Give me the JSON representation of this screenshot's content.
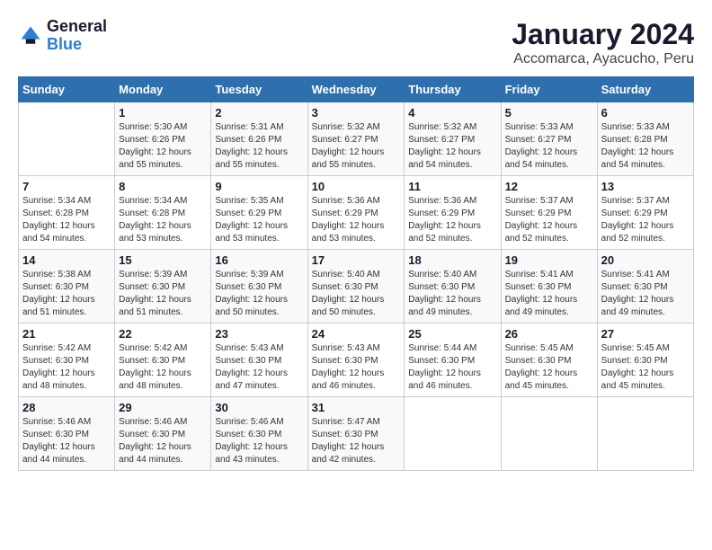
{
  "logo": {
    "text_general": "General",
    "text_blue": "Blue"
  },
  "header": {
    "title": "January 2024",
    "subtitle": "Accomarca, Ayacucho, Peru"
  },
  "columns": [
    "Sunday",
    "Monday",
    "Tuesday",
    "Wednesday",
    "Thursday",
    "Friday",
    "Saturday"
  ],
  "weeks": [
    [
      {
        "day": "",
        "info": ""
      },
      {
        "day": "1",
        "info": "Sunrise: 5:30 AM\nSunset: 6:26 PM\nDaylight: 12 hours\nand 55 minutes."
      },
      {
        "day": "2",
        "info": "Sunrise: 5:31 AM\nSunset: 6:26 PM\nDaylight: 12 hours\nand 55 minutes."
      },
      {
        "day": "3",
        "info": "Sunrise: 5:32 AM\nSunset: 6:27 PM\nDaylight: 12 hours\nand 55 minutes."
      },
      {
        "day": "4",
        "info": "Sunrise: 5:32 AM\nSunset: 6:27 PM\nDaylight: 12 hours\nand 54 minutes."
      },
      {
        "day": "5",
        "info": "Sunrise: 5:33 AM\nSunset: 6:27 PM\nDaylight: 12 hours\nand 54 minutes."
      },
      {
        "day": "6",
        "info": "Sunrise: 5:33 AM\nSunset: 6:28 PM\nDaylight: 12 hours\nand 54 minutes."
      }
    ],
    [
      {
        "day": "7",
        "info": "Sunrise: 5:34 AM\nSunset: 6:28 PM\nDaylight: 12 hours\nand 54 minutes."
      },
      {
        "day": "8",
        "info": "Sunrise: 5:34 AM\nSunset: 6:28 PM\nDaylight: 12 hours\nand 53 minutes."
      },
      {
        "day": "9",
        "info": "Sunrise: 5:35 AM\nSunset: 6:29 PM\nDaylight: 12 hours\nand 53 minutes."
      },
      {
        "day": "10",
        "info": "Sunrise: 5:36 AM\nSunset: 6:29 PM\nDaylight: 12 hours\nand 53 minutes."
      },
      {
        "day": "11",
        "info": "Sunrise: 5:36 AM\nSunset: 6:29 PM\nDaylight: 12 hours\nand 52 minutes."
      },
      {
        "day": "12",
        "info": "Sunrise: 5:37 AM\nSunset: 6:29 PM\nDaylight: 12 hours\nand 52 minutes."
      },
      {
        "day": "13",
        "info": "Sunrise: 5:37 AM\nSunset: 6:29 PM\nDaylight: 12 hours\nand 52 minutes."
      }
    ],
    [
      {
        "day": "14",
        "info": "Sunrise: 5:38 AM\nSunset: 6:30 PM\nDaylight: 12 hours\nand 51 minutes."
      },
      {
        "day": "15",
        "info": "Sunrise: 5:39 AM\nSunset: 6:30 PM\nDaylight: 12 hours\nand 51 minutes."
      },
      {
        "day": "16",
        "info": "Sunrise: 5:39 AM\nSunset: 6:30 PM\nDaylight: 12 hours\nand 50 minutes."
      },
      {
        "day": "17",
        "info": "Sunrise: 5:40 AM\nSunset: 6:30 PM\nDaylight: 12 hours\nand 50 minutes."
      },
      {
        "day": "18",
        "info": "Sunrise: 5:40 AM\nSunset: 6:30 PM\nDaylight: 12 hours\nand 49 minutes."
      },
      {
        "day": "19",
        "info": "Sunrise: 5:41 AM\nSunset: 6:30 PM\nDaylight: 12 hours\nand 49 minutes."
      },
      {
        "day": "20",
        "info": "Sunrise: 5:41 AM\nSunset: 6:30 PM\nDaylight: 12 hours\nand 49 minutes."
      }
    ],
    [
      {
        "day": "21",
        "info": "Sunrise: 5:42 AM\nSunset: 6:30 PM\nDaylight: 12 hours\nand 48 minutes."
      },
      {
        "day": "22",
        "info": "Sunrise: 5:42 AM\nSunset: 6:30 PM\nDaylight: 12 hours\nand 48 minutes."
      },
      {
        "day": "23",
        "info": "Sunrise: 5:43 AM\nSunset: 6:30 PM\nDaylight: 12 hours\nand 47 minutes."
      },
      {
        "day": "24",
        "info": "Sunrise: 5:43 AM\nSunset: 6:30 PM\nDaylight: 12 hours\nand 46 minutes."
      },
      {
        "day": "25",
        "info": "Sunrise: 5:44 AM\nSunset: 6:30 PM\nDaylight: 12 hours\nand 46 minutes."
      },
      {
        "day": "26",
        "info": "Sunrise: 5:45 AM\nSunset: 6:30 PM\nDaylight: 12 hours\nand 45 minutes."
      },
      {
        "day": "27",
        "info": "Sunrise: 5:45 AM\nSunset: 6:30 PM\nDaylight: 12 hours\nand 45 minutes."
      }
    ],
    [
      {
        "day": "28",
        "info": "Sunrise: 5:46 AM\nSunset: 6:30 PM\nDaylight: 12 hours\nand 44 minutes."
      },
      {
        "day": "29",
        "info": "Sunrise: 5:46 AM\nSunset: 6:30 PM\nDaylight: 12 hours\nand 44 minutes."
      },
      {
        "day": "30",
        "info": "Sunrise: 5:46 AM\nSunset: 6:30 PM\nDaylight: 12 hours\nand 43 minutes."
      },
      {
        "day": "31",
        "info": "Sunrise: 5:47 AM\nSunset: 6:30 PM\nDaylight: 12 hours\nand 42 minutes."
      },
      {
        "day": "",
        "info": ""
      },
      {
        "day": "",
        "info": ""
      },
      {
        "day": "",
        "info": ""
      }
    ]
  ]
}
